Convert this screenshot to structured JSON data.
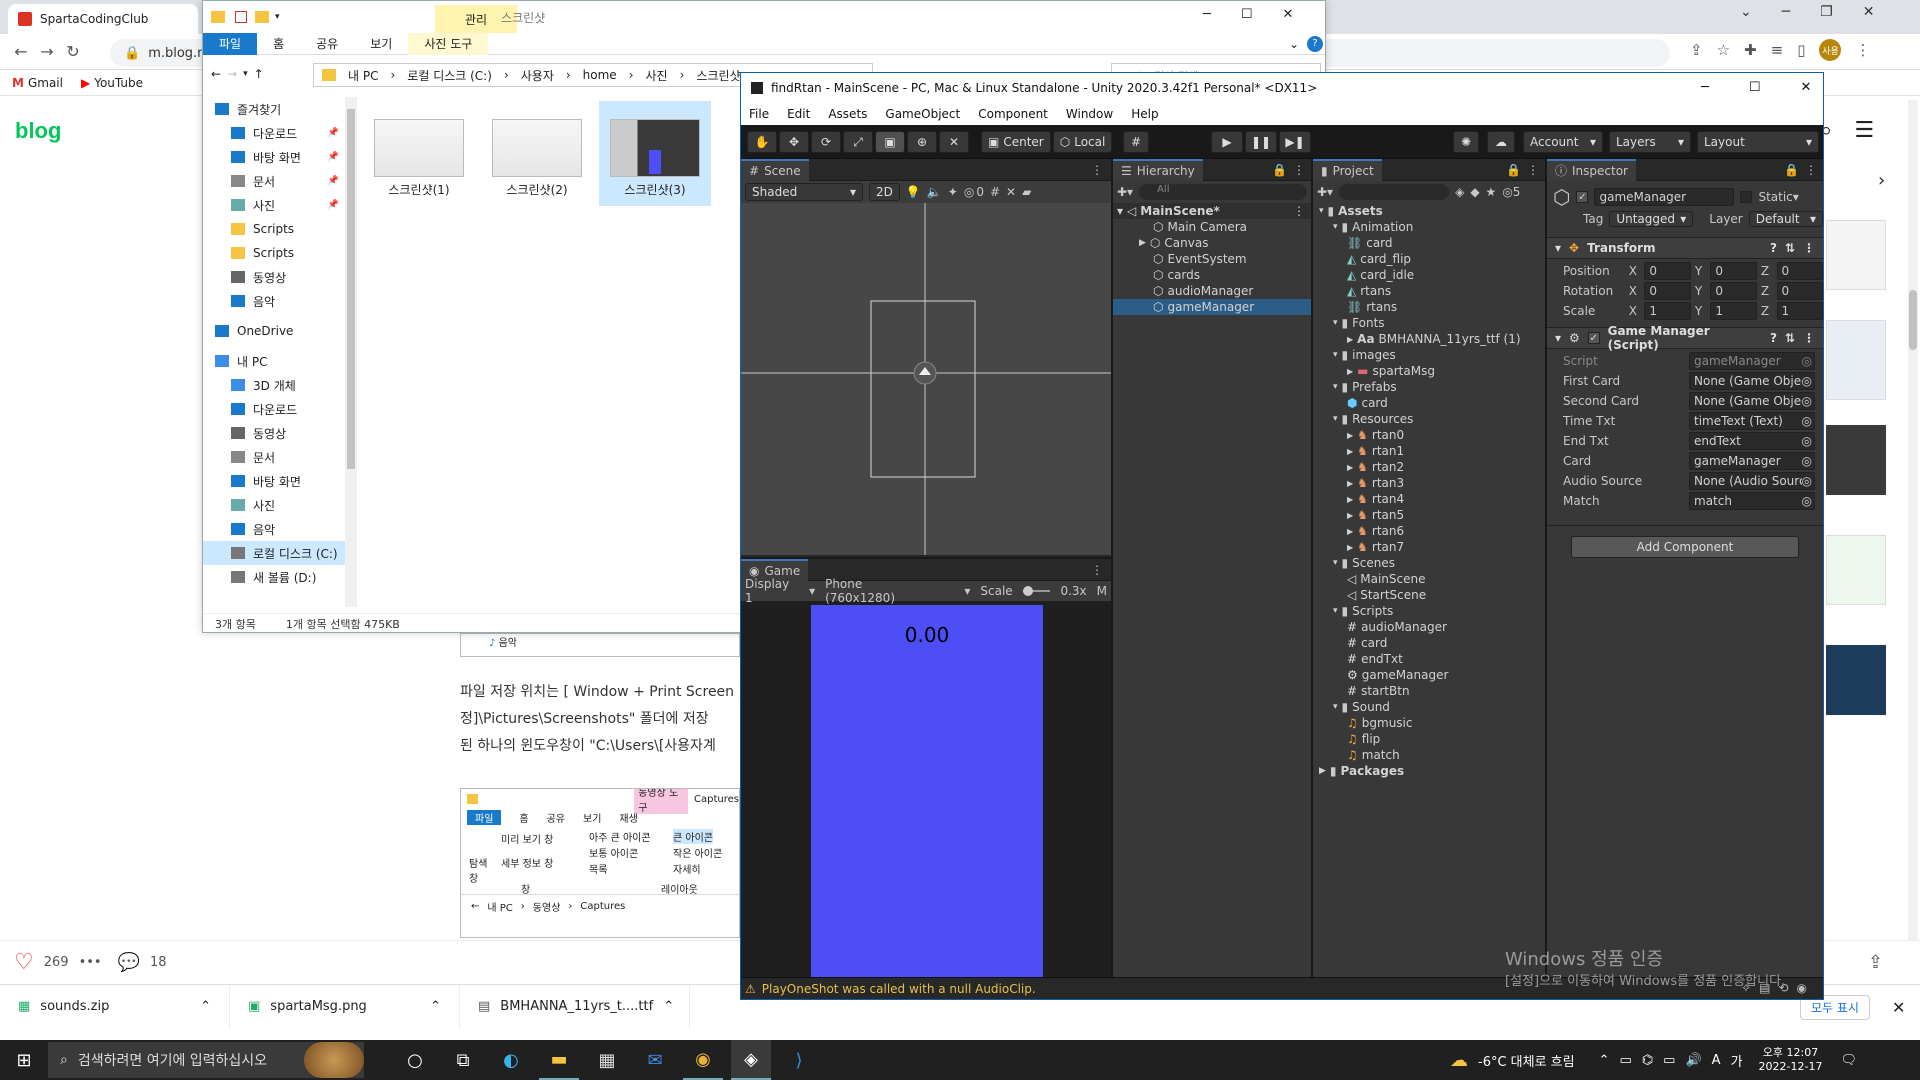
{
  "chrome": {
    "tab_title": "SpartaCodingClub",
    "url": "m.blog.na",
    "bookmarks": [
      "Gmail",
      "YouTube"
    ],
    "blog_logo": "blog",
    "profile": "사용"
  },
  "blog": {
    "paragraph_1": "파일 저장 위치는 [ Window + Print Screen ]",
    "paragraph_2": "정]\\Pictures\\Screenshots\" 폴더에 저장",
    "paragraph_3": "된 하나의 윈도우창이 \"C:\\Users\\[사용자계",
    "likes": "269",
    "comments": "18",
    "embedded_ribbon": {
      "tool_tab": "동영상 도구",
      "folder": "Captures",
      "tabs": [
        "파일",
        "홈",
        "공유",
        "보기",
        "재생"
      ],
      "items": [
        "미리 보기 창",
        "세부 정보 창",
        "아주 큰 아이콘",
        "큰 아이콘",
        "보통 아이콘",
        "작은 아이콘",
        "목록",
        "자세히"
      ],
      "group_pane": "창",
      "group_layout": "레이아웃",
      "nav_label": "탐색 창",
      "path": [
        "내 PC",
        "동영상",
        "Captures"
      ],
      "partial_item": "음악"
    }
  },
  "explorer": {
    "ribbon_context": "관리",
    "ribbon_context_tab": "사진 도구",
    "title": "스크린샷",
    "tabs": [
      "파일",
      "홈",
      "공유",
      "보기"
    ],
    "path": [
      "내 PC",
      "로컬 디스크 (C:)",
      "사용자",
      "home",
      "사진",
      "스크린샷"
    ],
    "search_placeholder": "스크린샷 검색",
    "nav": [
      {
        "label": "즐겨찾기",
        "icon": "star-icon",
        "indent": 0
      },
      {
        "label": "다운로드",
        "icon": "download-icon",
        "indent": 1
      },
      {
        "label": "바탕 화면",
        "icon": "desktop-icon",
        "indent": 1
      },
      {
        "label": "문서",
        "icon": "document-icon",
        "indent": 1
      },
      {
        "label": "사진",
        "icon": "picture-icon",
        "indent": 1
      },
      {
        "label": "Scripts",
        "icon": "folder-icon",
        "indent": 1
      },
      {
        "label": "Scripts",
        "icon": "folder-icon",
        "indent": 1
      },
      {
        "label": "동영상",
        "icon": "video-icon",
        "indent": 1
      },
      {
        "label": "음악",
        "icon": "music-icon",
        "indent": 1
      },
      {
        "label": "OneDrive",
        "icon": "cloud-icon",
        "indent": 0
      },
      {
        "label": "내 PC",
        "icon": "pc-icon",
        "indent": 0
      },
      {
        "label": "3D 개체",
        "icon": "cube-icon",
        "indent": 1
      },
      {
        "label": "다운로드",
        "icon": "download-icon",
        "indent": 1
      },
      {
        "label": "동영상",
        "icon": "video-icon",
        "indent": 1
      },
      {
        "label": "문서",
        "icon": "document-icon",
        "indent": 1
      },
      {
        "label": "바탕 화면",
        "icon": "desktop-icon",
        "indent": 1
      },
      {
        "label": "사진",
        "icon": "picture-icon",
        "indent": 1
      },
      {
        "label": "음악",
        "icon": "music-icon",
        "indent": 1
      },
      {
        "label": "로컬 디스크 (C:)",
        "icon": "disk-icon",
        "indent": 1,
        "selected": true
      },
      {
        "label": "새 볼륨 (D:)",
        "icon": "disk-icon",
        "indent": 1
      }
    ],
    "files": [
      {
        "name": "스크린샷(1)",
        "selected": false
      },
      {
        "name": "스크린샷(2)",
        "selected": false
      },
      {
        "name": "스크린샷(3)",
        "selected": true
      }
    ],
    "status_count": "3개 항목",
    "status_selected": "1개 항목 선택함 475KB"
  },
  "unity": {
    "title": "findRtan - MainScene - PC, Mac & Linux Standalone - Unity 2020.3.42f1 Personal* <DX11>",
    "menu": [
      "File",
      "Edit",
      "Assets",
      "GameObject",
      "Component",
      "Window",
      "Help"
    ],
    "toolbar": {
      "pivot": "Center",
      "space": "Local",
      "account": "Account",
      "layers": "Layers",
      "layout": "Layout"
    },
    "scene": {
      "tab": "Scene",
      "shading": "Shaded",
      "mode_2d": "2D",
      "hidden_count": "0"
    },
    "game": {
      "tab": "Game",
      "display": "Display 1",
      "resolution": "Phone (760x1280)",
      "scale_label": "Scale",
      "scale_value": "0.3x",
      "score_text": "0.00",
      "overflow": "M"
    },
    "hierarchy": {
      "tab": "Hierarchy",
      "search_placeholder": "All",
      "scene": "MainScene*",
      "items": [
        "Main Camera",
        "Canvas",
        "EventSystem",
        "cards",
        "audioManager",
        "gameManager"
      ],
      "selected": "gameManager"
    },
    "project": {
      "tab": "Project",
      "hidden_count": "5",
      "tree": [
        {
          "label": "Assets",
          "depth": 0,
          "type": "folder",
          "bold": true
        },
        {
          "label": "Animation",
          "depth": 1,
          "type": "folder"
        },
        {
          "label": "card",
          "depth": 2,
          "type": "anim"
        },
        {
          "label": "card_flip",
          "depth": 2,
          "type": "clip"
        },
        {
          "label": "card_idle",
          "depth": 2,
          "type": "clip"
        },
        {
          "label": "rtans",
          "depth": 2,
          "type": "clip"
        },
        {
          "label": "rtans",
          "depth": 2,
          "type": "anim"
        },
        {
          "label": "Fonts",
          "depth": 1,
          "type": "folder"
        },
        {
          "label": "BMHANNA_11yrs_ttf (1)",
          "depth": 2,
          "type": "font",
          "prefix": "Aa"
        },
        {
          "label": "images",
          "depth": 1,
          "type": "folder"
        },
        {
          "label": "spartaMsg",
          "depth": 2,
          "type": "image"
        },
        {
          "label": "Prefabs",
          "depth": 1,
          "type": "folder"
        },
        {
          "label": "card",
          "depth": 2,
          "type": "prefab"
        },
        {
          "label": "Resources",
          "depth": 1,
          "type": "folder"
        },
        {
          "label": "rtan0",
          "depth": 2,
          "type": "sprite"
        },
        {
          "label": "rtan1",
          "depth": 2,
          "type": "sprite"
        },
        {
          "label": "rtan2",
          "depth": 2,
          "type": "sprite"
        },
        {
          "label": "rtan3",
          "depth": 2,
          "type": "sprite"
        },
        {
          "label": "rtan4",
          "depth": 2,
          "type": "sprite"
        },
        {
          "label": "rtan5",
          "depth": 2,
          "type": "sprite"
        },
        {
          "label": "rtan6",
          "depth": 2,
          "type": "sprite"
        },
        {
          "label": "rtan7",
          "depth": 2,
          "type": "sprite"
        },
        {
          "label": "Scenes",
          "depth": 1,
          "type": "folder"
        },
        {
          "label": "MainScene",
          "depth": 2,
          "type": "scene"
        },
        {
          "label": "StartScene",
          "depth": 2,
          "type": "scene"
        },
        {
          "label": "Scripts",
          "depth": 1,
          "type": "folder"
        },
        {
          "label": "audioManager",
          "depth": 2,
          "type": "script"
        },
        {
          "label": "card",
          "depth": 2,
          "type": "script"
        },
        {
          "label": "endTxt",
          "depth": 2,
          "type": "script"
        },
        {
          "label": "gameManager",
          "depth": 2,
          "type": "gear"
        },
        {
          "label": "startBtn",
          "depth": 2,
          "type": "script"
        },
        {
          "label": "Sound",
          "depth": 1,
          "type": "folder"
        },
        {
          "label": "bgmusic",
          "depth": 2,
          "type": "audio"
        },
        {
          "label": "flip",
          "depth": 2,
          "type": "audio"
        },
        {
          "label": "match",
          "depth": 2,
          "type": "audio"
        },
        {
          "label": "Packages",
          "depth": 0,
          "type": "folder",
          "bold": true
        }
      ]
    },
    "inspector": {
      "tab": "Inspector",
      "object_name": "gameManager",
      "static_label": "Static",
      "tag_label": "Tag",
      "tag_value": "Untagged",
      "layer_label": "Layer",
      "layer_value": "Default",
      "transform_title": "Transform",
      "transform": [
        {
          "label": "Position",
          "x": "0",
          "y": "0",
          "z": "0"
        },
        {
          "label": "Rotation",
          "x": "0",
          "y": "0",
          "z": "0"
        },
        {
          "label": "Scale",
          "x": "1",
          "y": "1",
          "z": "1"
        }
      ],
      "script_title": "Game Manager (Script)",
      "fields": [
        {
          "label": "Script",
          "value": "gameManager",
          "dim": true
        },
        {
          "label": "First Card",
          "value": "None (Game Object"
        },
        {
          "label": "Second Card",
          "value": "None (Game Object"
        },
        {
          "label": "Time Txt",
          "value": "timeText (Text)"
        },
        {
          "label": "End Txt",
          "value": "endText"
        },
        {
          "label": "Card",
          "value": "gameManager"
        },
        {
          "label": "Audio Source",
          "value": "None (Audio Source"
        },
        {
          "label": "Match",
          "value": "match"
        }
      ],
      "add_component": "Add Component"
    },
    "console_message": "PlayOneShot was called with a null AudioClip."
  },
  "windows": {
    "activation_title": "Windows 정품 인증",
    "activation_sub": "[설정]으로 이동하여 Windows를 정품 인증합니다.",
    "search_placeholder": "검색하려면 여기에 입력하십시오",
    "weather": "-6°C 대체로 흐림",
    "ime": "A",
    "ime2": "가",
    "time": "오후 12:07",
    "date": "2022-12-17"
  },
  "downloads": {
    "items": [
      "sounds.zip",
      "spartaMsg.png",
      "BMHANNA_11yrs_t....ttf"
    ],
    "show_all": "모두 표시"
  },
  "colors": {
    "unity_bg": "#191919",
    "unity_panel": "#383838",
    "selection": "#2c5d87",
    "game_canvas": "#4e4ef6",
    "explorer_accent": "#1979ca",
    "naver_green": "#03c75a"
  }
}
